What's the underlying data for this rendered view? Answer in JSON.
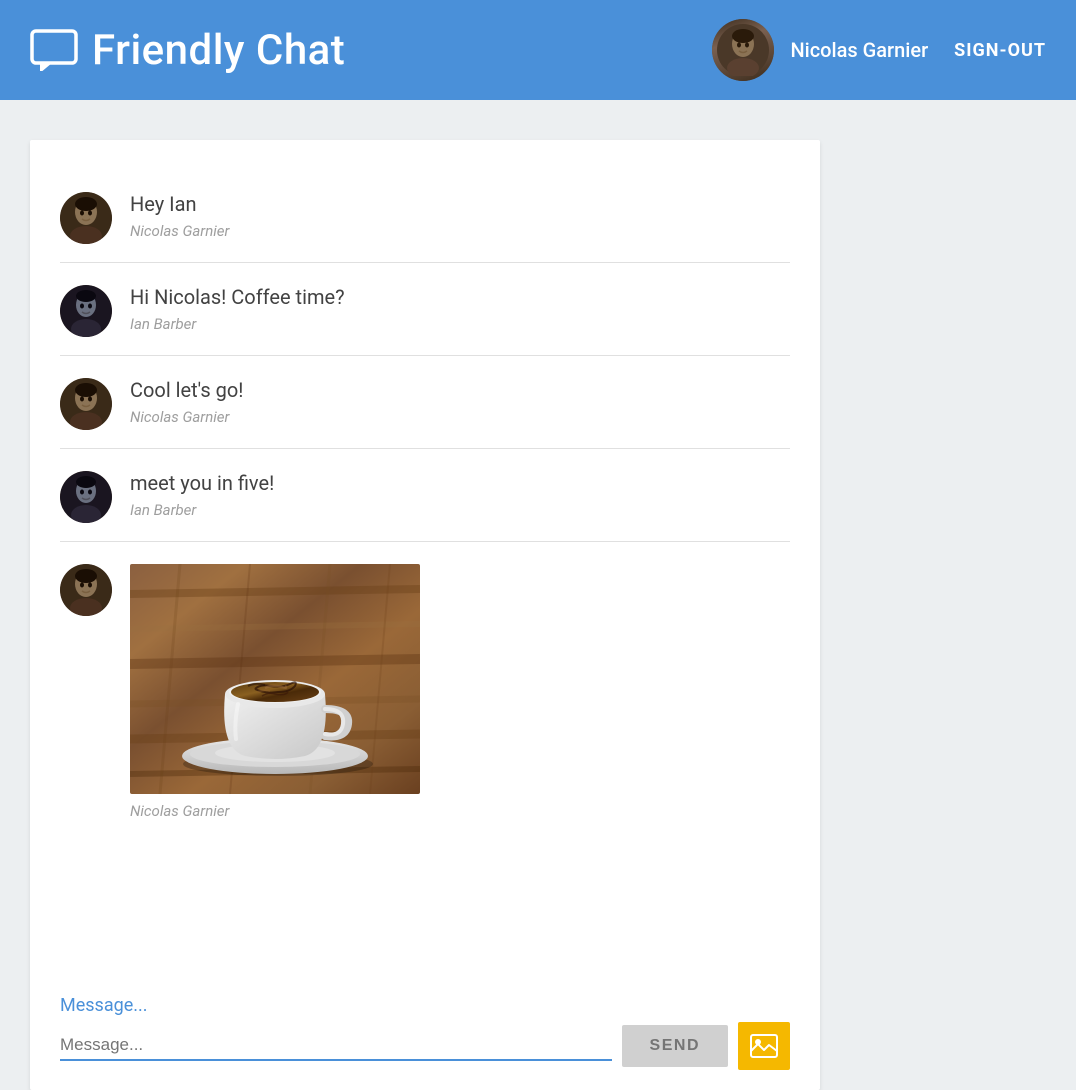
{
  "header": {
    "logo_icon_label": "chat-bubble-icon",
    "title": "Friendly Chat",
    "user": {
      "name": "Nicolas Garnier",
      "avatar_alt": "Nicolas Garnier avatar"
    },
    "signout_label": "SIGN-OUT"
  },
  "messages": [
    {
      "id": 1,
      "text": "Hey Ian",
      "sender": "Nicolas Garnier",
      "avatar_type": "nicolas"
    },
    {
      "id": 2,
      "text": "Hi Nicolas! Coffee time?",
      "sender": "Ian Barber",
      "avatar_type": "ian"
    },
    {
      "id": 3,
      "text": "Cool let's go!",
      "sender": "Nicolas Garnier",
      "avatar_type": "nicolas"
    },
    {
      "id": 4,
      "text": "meet you in five!",
      "sender": "Ian Barber",
      "avatar_type": "ian"
    },
    {
      "id": 5,
      "text": null,
      "image": true,
      "sender": "Nicolas Garnier",
      "avatar_type": "nicolas"
    }
  ],
  "input": {
    "placeholder": "Message...",
    "send_label": "SEND",
    "image_icon_label": "image-upload-icon"
  },
  "colors": {
    "header_bg": "#4a90d9",
    "accent": "#4a90d9",
    "send_bg": "#d0d0d0",
    "image_btn_bg": "#f5b800"
  }
}
